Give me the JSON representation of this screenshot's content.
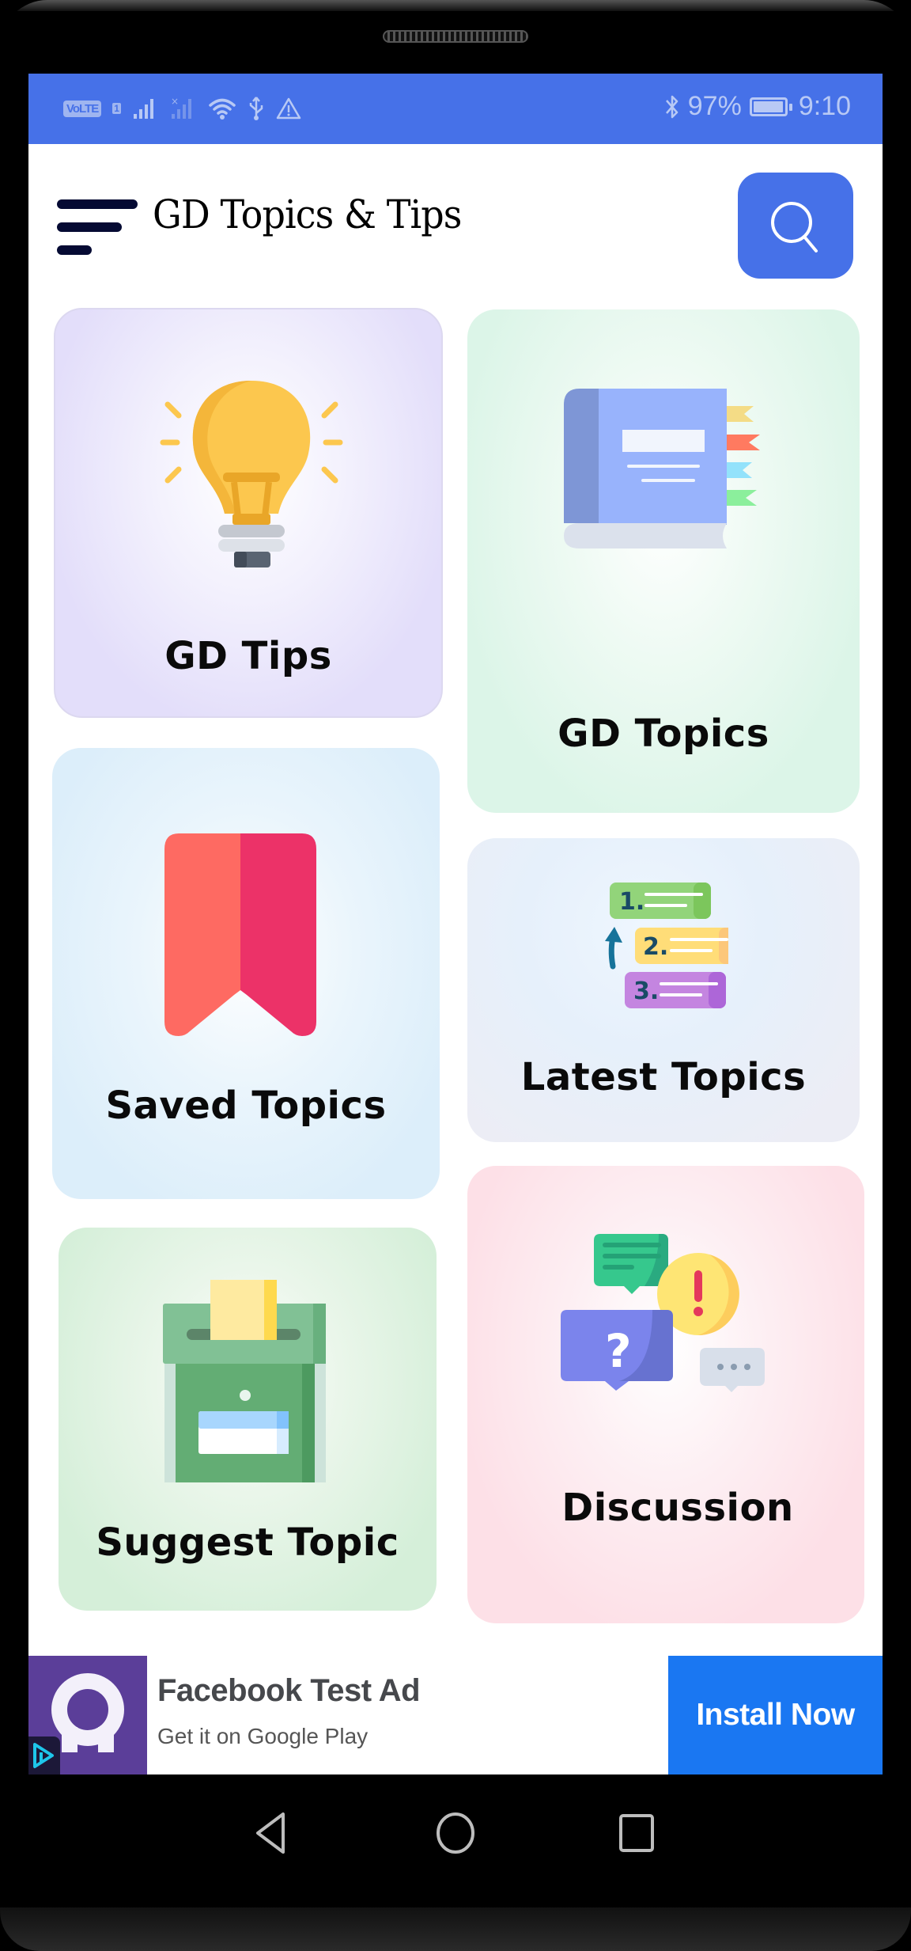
{
  "status_bar": {
    "volte": "VoLTE",
    "sim_slot": "1",
    "battery_percent": "97%",
    "battery_level": 0.97,
    "time": "9:10",
    "icons": [
      "volte-icon",
      "signal-icon",
      "signal-no-sim-icon",
      "wifi-icon",
      "usb-icon",
      "warning-icon",
      "bluetooth-icon",
      "battery-charging-icon"
    ]
  },
  "header": {
    "title": "GD Topics & Tips",
    "menu_icon": "menu-icon",
    "search_icon": "search-icon"
  },
  "cards": [
    {
      "id": "gd-tips",
      "label": "GD Tips",
      "icon": "lightbulb-icon",
      "bg_color": "#E3DEFA"
    },
    {
      "id": "gd-topics",
      "label": "GD Topics",
      "icon": "book-icon",
      "bg_color": "#DCF5E8"
    },
    {
      "id": "saved-topics",
      "label": "Saved Topics",
      "icon": "bookmark-icon",
      "bg_color": "#DCEEFA"
    },
    {
      "id": "latest-topics",
      "label": "Latest Topics",
      "icon": "ranked-list-icon",
      "bg_color": "#ECEDF5"
    },
    {
      "id": "suggest-topic",
      "label": "Suggest Topic",
      "icon": "ballot-box-icon",
      "bg_color": "#D5EFD9"
    },
    {
      "id": "discussion",
      "label": "Discussion",
      "icon": "chat-bubbles-icon",
      "bg_color": "#FDE0E7"
    }
  ],
  "latest_icon_numbers": [
    "1.",
    "2.",
    "3."
  ],
  "ad": {
    "title": "Facebook Test Ad",
    "subtitle": "Get it on Google Play",
    "cta": "Install Now",
    "cta_color": "#1A77F2",
    "logo_color": "#5B3E99"
  },
  "nav_bar": {
    "back": "back-icon",
    "home": "home-icon",
    "recents": "recents-icon"
  },
  "colors": {
    "accent": "#4671E8",
    "title_text": "#000000",
    "menu_icon": "#050A33"
  }
}
